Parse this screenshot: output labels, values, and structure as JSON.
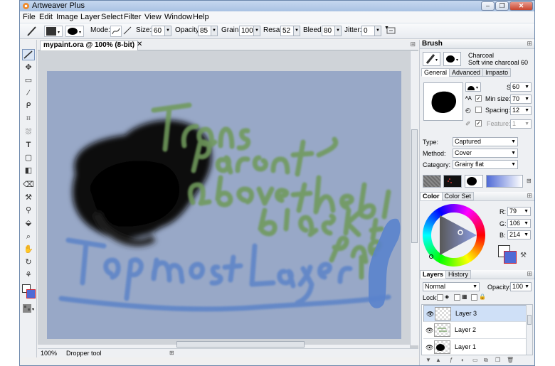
{
  "window": {
    "title": "Artweaver Plus",
    "controls": [
      "–",
      "❐",
      "✕"
    ]
  },
  "menu": [
    "File",
    "Edit",
    "Image",
    "Layer",
    "Select",
    "Filter",
    "View",
    "Window",
    "Help"
  ],
  "toolbar": {
    "mode_label": "Mode:",
    "size_label": "Size:",
    "size_value": "60",
    "opacity_label": "Opacity:",
    "opacity_value": "85",
    "grain_label": "Grain:",
    "grain_value": "100",
    "resat_label": "Resat:",
    "resat_value": "52",
    "bleed_label": "Bleed:",
    "bleed_value": "80",
    "jitter_label": "Jitter:",
    "jitter_value": "0"
  },
  "document": {
    "tab_title": "mypaint.ora @ 100% (8-bit)",
    "close_glyph": "✕",
    "canvas_color": "#98a8c7",
    "texts": {
      "line1": "Transparent",
      "line2": "above the black",
      "line3": "blob layer",
      "line4": "Topmost Layer"
    }
  },
  "status": {
    "zoom": "100%",
    "tool": "Dropper tool"
  },
  "brush_panel": {
    "title": "Brush",
    "brush_category": "Charcoal",
    "brush_variant": "Soft vine charcoal 60",
    "tabs": [
      "General",
      "Advanced",
      "Impasto"
    ],
    "size_label": "Size:",
    "size_value": "60",
    "min_size_label": "Min size:",
    "min_size_value": "70",
    "spacing_label": "Spacing:",
    "spacing_value": "12",
    "feature_label": "Feature:",
    "feature_value": "1",
    "type_label": "Type:",
    "type_value": "Captured",
    "method_label": "Method:",
    "method_value": "Cover",
    "category_label": "Category:",
    "category_value": "Grainy flat"
  },
  "color_panel": {
    "tabs": [
      "Color",
      "Color Set"
    ],
    "r_label": "R:",
    "r_value": "79",
    "g_label": "G:",
    "g_value": "106",
    "b_label": "B:",
    "b_value": "214",
    "current_color": "#4f6ad6"
  },
  "layers_panel": {
    "tabs": [
      "Layers",
      "History"
    ],
    "blend_mode": "Normal",
    "opacity_label": "Opacity:",
    "opacity_value": "100",
    "lock_label": "Lock:",
    "layers": [
      {
        "name": "Layer 3",
        "selected": true
      },
      {
        "name": "Layer 2",
        "selected": false
      },
      {
        "name": "Layer 1",
        "selected": false
      }
    ]
  }
}
